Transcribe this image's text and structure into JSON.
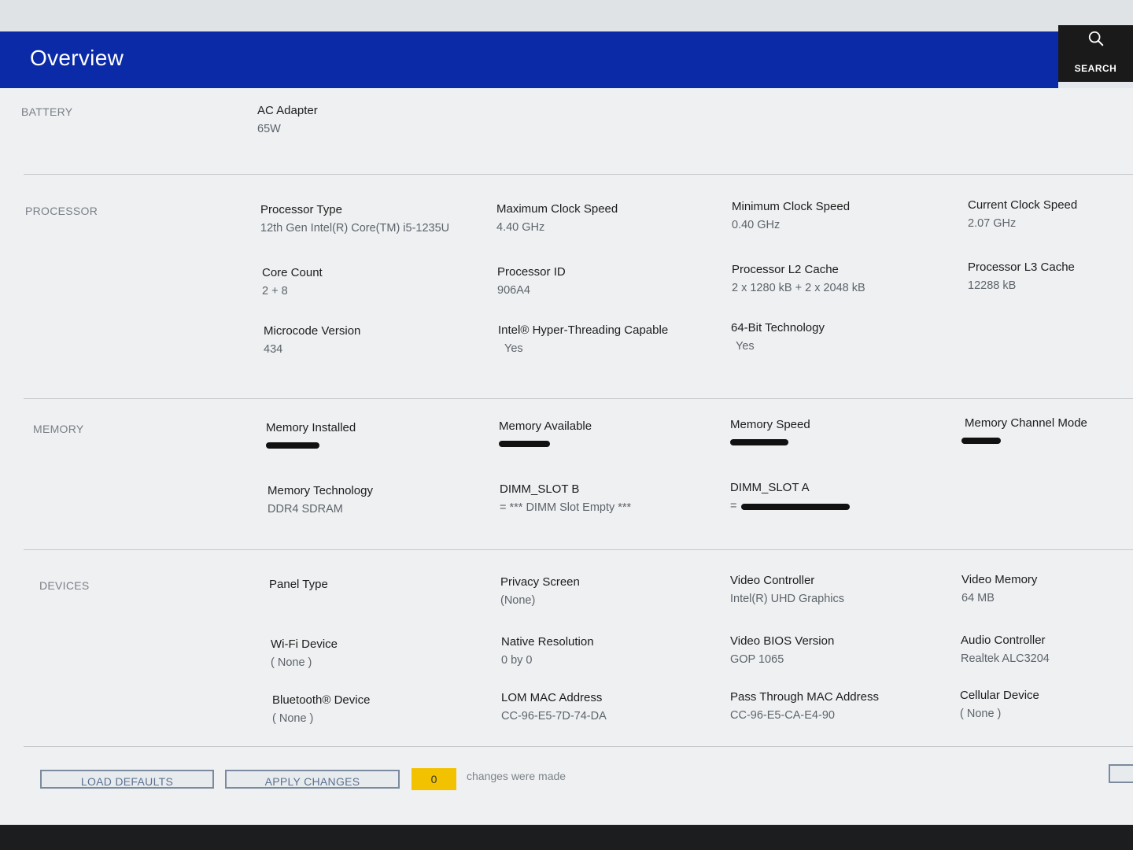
{
  "header": {
    "title": "Overview",
    "search_label": "SEARCH",
    "search_icon": "search-icon"
  },
  "battery": {
    "label": "BATTERY",
    "fields": [
      {
        "label": "AC Adapter",
        "value": "65W"
      }
    ]
  },
  "processor": {
    "label": "PROCESSOR",
    "fields": [
      {
        "label": "Processor Type",
        "value": "12th Gen Intel(R) Core(TM) i5-1235U"
      },
      {
        "label": "Maximum Clock Speed",
        "value": "4.40 GHz"
      },
      {
        "label": "Minimum Clock Speed",
        "value": "0.40 GHz"
      },
      {
        "label": "Current Clock Speed",
        "value": "2.07 GHz"
      },
      {
        "label": "Core Count",
        "value": "2 + 8"
      },
      {
        "label": "Processor ID",
        "value": "906A4"
      },
      {
        "label": "Processor L2 Cache",
        "value": "2 x 1280  kB + 2 x 2048  kB"
      },
      {
        "label": "Processor L3 Cache",
        "value": "12288 kB"
      },
      {
        "label": "Microcode Version",
        "value": "434"
      },
      {
        "label": "Intel® Hyper-Threading Capable",
        "value": "Yes"
      },
      {
        "label": "64-Bit Technology",
        "value": "Yes"
      }
    ]
  },
  "memory": {
    "label": "MEMORY",
    "fields": [
      {
        "label": "Memory Installed",
        "value": ""
      },
      {
        "label": "Memory Available",
        "value": ""
      },
      {
        "label": "Memory Speed",
        "value": ""
      },
      {
        "label": "Memory Channel Mode",
        "value": ""
      },
      {
        "label": "Memory Technology",
        "value": "DDR4 SDRAM"
      },
      {
        "label": "DIMM_SLOT B",
        "value": "= *** DIMM Slot Empty ***"
      },
      {
        "label": "DIMM_SLOT A",
        "value": "="
      }
    ]
  },
  "devices": {
    "label": "DEVICES",
    "fields": [
      {
        "label": "Panel Type",
        "value": ""
      },
      {
        "label": "Privacy Screen",
        "value": "(None)"
      },
      {
        "label": "Video Controller",
        "value": "Intel(R) UHD Graphics"
      },
      {
        "label": "Video Memory",
        "value": "64 MB"
      },
      {
        "label": "Wi-Fi Device",
        "value": "( None )"
      },
      {
        "label": "Native Resolution",
        "value": "0 by 0"
      },
      {
        "label": "Video BIOS Version",
        "value": "GOP 1065"
      },
      {
        "label": "Audio Controller",
        "value": "Realtek ALC3204"
      },
      {
        "label": "Bluetooth® Device",
        "value": "( None )"
      },
      {
        "label": "LOM MAC Address",
        "value": "CC-96-E5-7D-74-DA"
      },
      {
        "label": "Pass Through MAC Address",
        "value": "CC-96-E5-CA-E4-90"
      },
      {
        "label": "Cellular Device",
        "value": "( None )"
      }
    ]
  },
  "footer": {
    "load_defaults": "LOAD DEFAULTS",
    "apply_changes": "APPLY CHANGES",
    "change_count": "0",
    "changes_text": "changes were made"
  },
  "colors": {
    "header_bg": "#0b2aa8",
    "counter_bg": "#f2c200",
    "search_bg": "#1a1a1a"
  }
}
